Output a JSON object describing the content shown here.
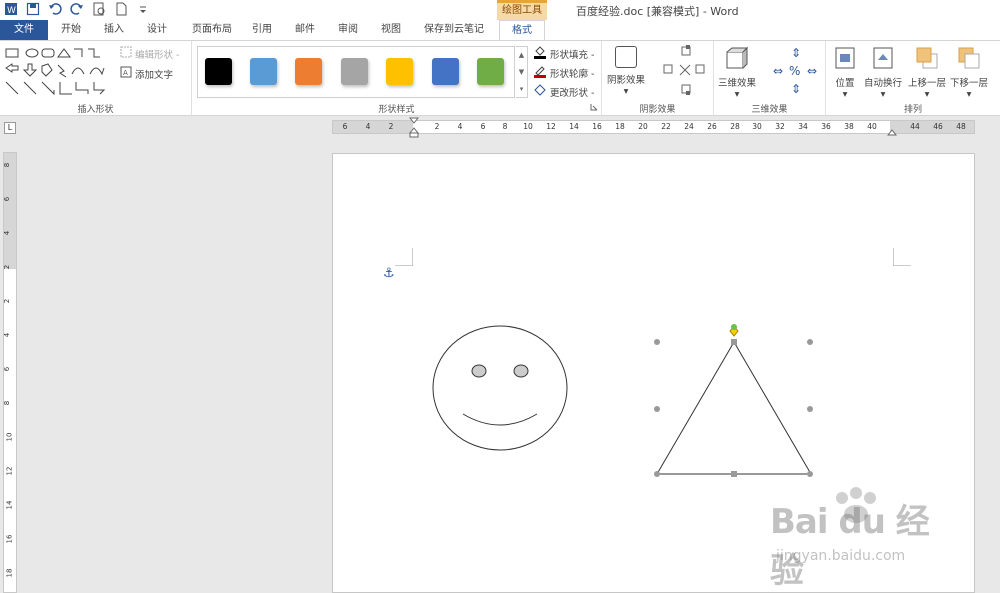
{
  "titlebar": {
    "context_group": "绘图工具",
    "doc_title": "百度经验.doc [兼容模式] - Word"
  },
  "tabs": [
    {
      "label": "文件"
    },
    {
      "label": "开始"
    },
    {
      "label": "插入"
    },
    {
      "label": "设计"
    },
    {
      "label": "页面布局"
    },
    {
      "label": "引用"
    },
    {
      "label": "邮件"
    },
    {
      "label": "审阅"
    },
    {
      "label": "视图"
    },
    {
      "label": "保存到云笔记"
    },
    {
      "label": "格式"
    }
  ],
  "ribbon": {
    "insert_shapes": {
      "label": "插入形状",
      "edit_shape": "编辑形状 -",
      "add_text": "添加文字"
    },
    "shape_styles": {
      "label": "形状样式",
      "swatches": [
        "#000000",
        "#5b9bd5",
        "#ed7d31",
        "#a5a5a5",
        "#ffc000",
        "#4472c4",
        "#70ad47"
      ],
      "fill": "形状填充 -",
      "outline": "形状轮廓 -",
      "change": "更改形状 -"
    },
    "shadow": {
      "label": "阴影效果",
      "button": "阴影效果"
    },
    "threed": {
      "label": "三维效果",
      "button": "三维效果"
    },
    "arrange": {
      "label": "排列",
      "position": "位置",
      "wrap": "自动换行",
      "forward": "上移一层",
      "backward": "下移一层"
    }
  },
  "ruler": {
    "h_ticks": [
      "6",
      "4",
      "2",
      "2",
      "4",
      "6",
      "8",
      "10",
      "12",
      "14",
      "16",
      "18",
      "20",
      "22",
      "24",
      "26",
      "28",
      "30",
      "32",
      "34",
      "36",
      "38",
      "40",
      "44",
      "46",
      "48"
    ],
    "v_ticks": [
      "8",
      "6",
      "4",
      "2",
      "2",
      "4",
      "6",
      "8",
      "10",
      "12",
      "14",
      "16",
      "18"
    ]
  },
  "watermark": {
    "main": "Bai du 经验",
    "sub": "jingyan.baidu.com"
  }
}
